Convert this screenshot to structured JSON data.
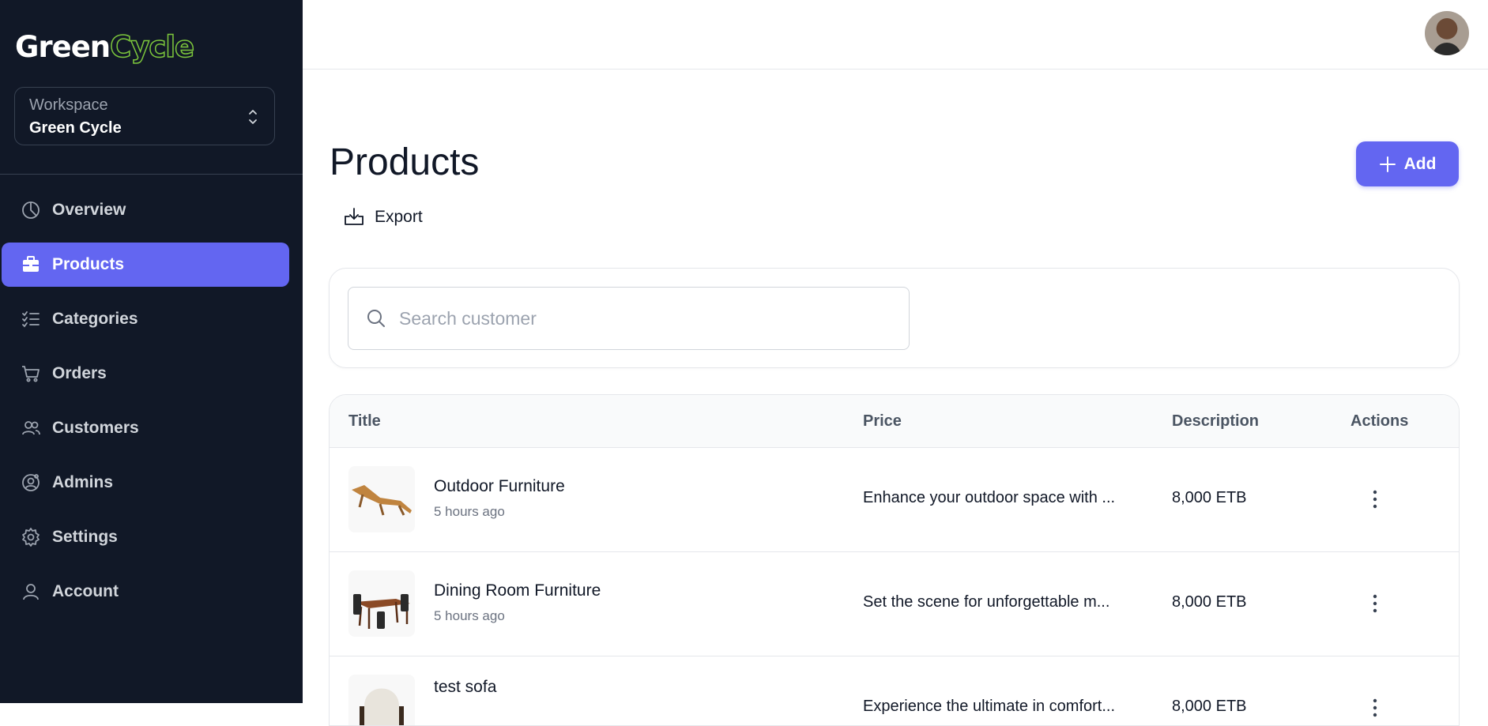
{
  "brand": {
    "logo_part1": "Green",
    "logo_part2": "Cycle",
    "accent": "#6366f1",
    "logo_green": "#7cc63c"
  },
  "workspace": {
    "label": "Workspace",
    "value": "Green Cycle"
  },
  "sidebar": {
    "items": [
      {
        "label": "Overview",
        "icon": "pie-chart-icon",
        "active": false
      },
      {
        "label": "Products",
        "icon": "briefcase-icon",
        "active": true
      },
      {
        "label": "Categories",
        "icon": "checklist-icon",
        "active": false
      },
      {
        "label": "Orders",
        "icon": "cart-icon",
        "active": false
      },
      {
        "label": "Customers",
        "icon": "users-icon",
        "active": false
      },
      {
        "label": "Admins",
        "icon": "user-gear-icon",
        "active": false
      },
      {
        "label": "Settings",
        "icon": "gear-icon",
        "active": false
      },
      {
        "label": "Account",
        "icon": "user-icon",
        "active": false
      }
    ]
  },
  "header": {
    "title": "Products",
    "add_label": "Add",
    "export_label": "Export"
  },
  "search": {
    "placeholder": "Search customer",
    "value": ""
  },
  "table": {
    "columns": [
      "Title",
      "Price",
      "Description",
      "Actions"
    ],
    "rows": [
      {
        "title": "Outdoor Furniture",
        "time": "5 hours ago",
        "desc": "Enhance your outdoor space with ...",
        "price": "8,000 ETB"
      },
      {
        "title": "Dining Room Furniture",
        "time": "5 hours ago",
        "desc": "Set the scene for unforgettable m...",
        "price": "8,000 ETB"
      },
      {
        "title": "test sofa",
        "time": "",
        "desc": "Experience the ultimate in comfort...",
        "price": "8,000 ETB"
      }
    ]
  }
}
